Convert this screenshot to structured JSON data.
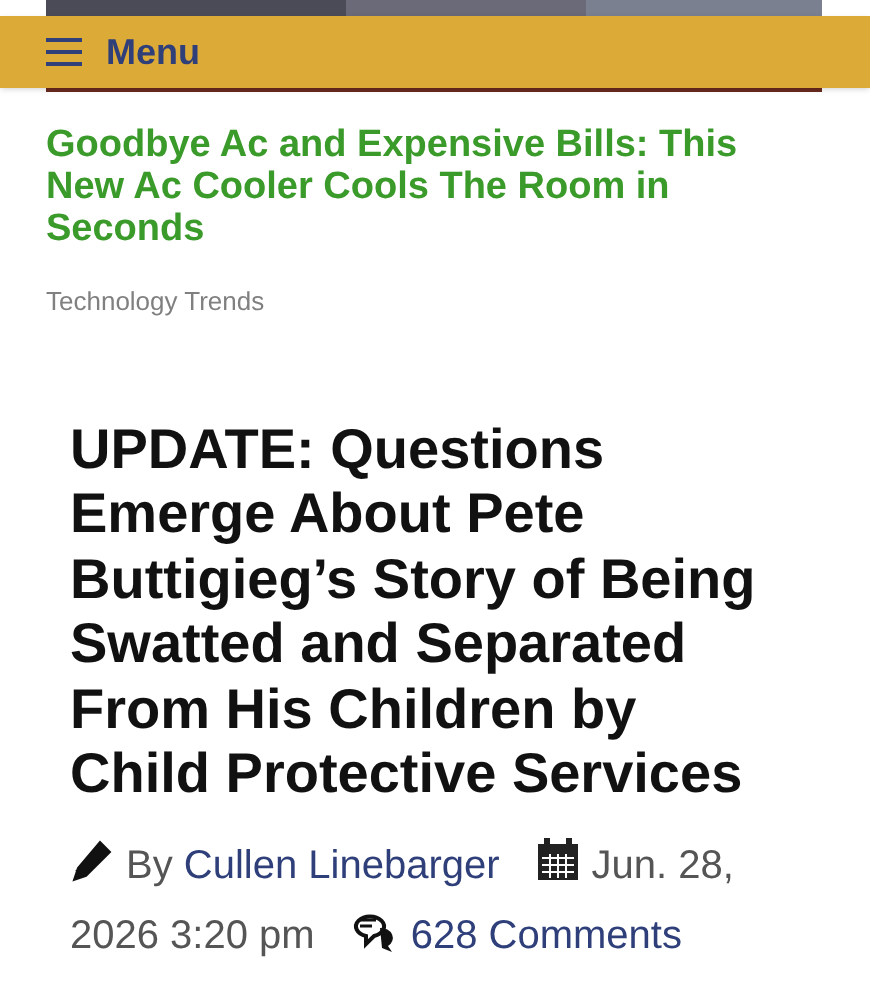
{
  "menu": {
    "label": "Menu"
  },
  "related": {
    "title": "Goodbye Ac and Expensive Bills: This New Ac Cooler Cools The Room in Seconds",
    "category": "Technology Trends"
  },
  "article": {
    "title": "UPDATE: Questions Emerge About Pete Buttigieg’s Story of Being Swatted and Separated From His Children by Child Protective Services",
    "by": "By",
    "author": "Cullen Linebarger",
    "date_line_1": "Jun. 28,",
    "date_line_2": "2026 3:20 pm",
    "comments": "628 Comments"
  }
}
